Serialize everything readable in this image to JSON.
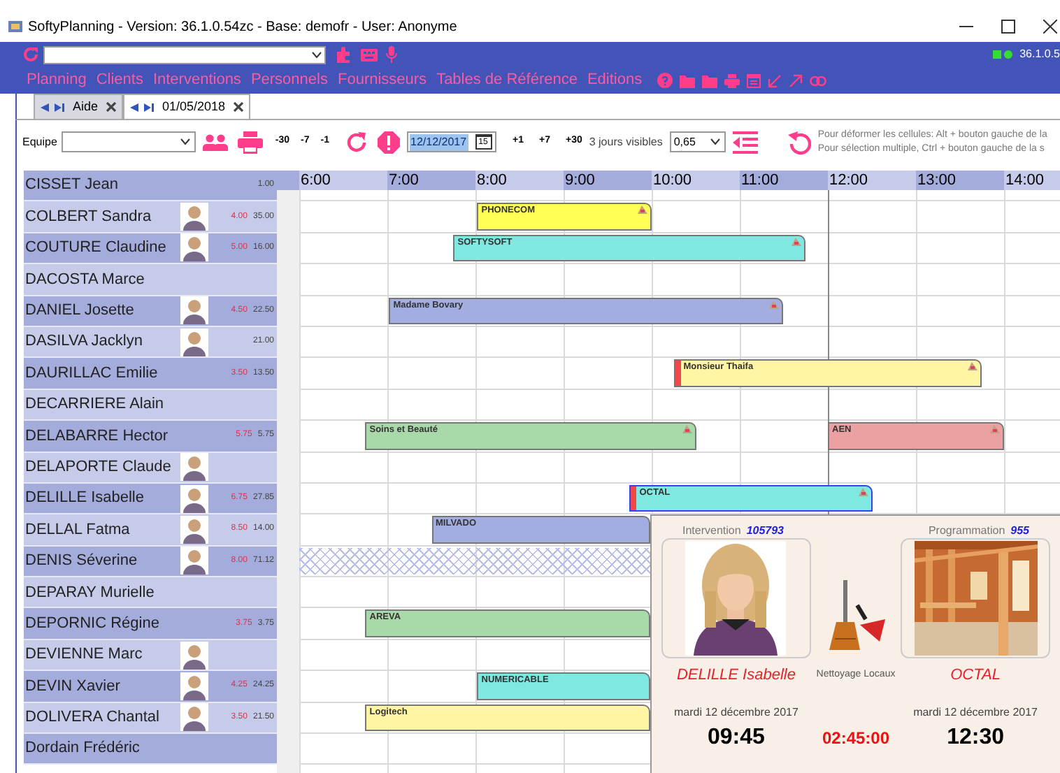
{
  "window": {
    "title": "SoftyPlanning - Version: 36.1.0.54zc - Base: demofr - User: Anonyme"
  },
  "top_bar": {
    "version": "36.1.0.5"
  },
  "menu": [
    {
      "label": "Planning"
    },
    {
      "label": "Clients"
    },
    {
      "label": "Interventions"
    },
    {
      "label": "Personnels"
    },
    {
      "label": "Fournisseurs"
    },
    {
      "label": "Tables de Référence"
    },
    {
      "label": "Editions"
    }
  ],
  "tabs": [
    {
      "label": "Aide",
      "selected": false
    },
    {
      "label": "01/05/2018",
      "selected": true
    }
  ],
  "toolbar": {
    "team_label": "Equipe",
    "back_steps": [
      "-30",
      "-7",
      "-1"
    ],
    "date": "12/12/2017",
    "calendar_day": "15",
    "forward_steps": [
      "+1",
      "+7",
      "+30"
    ],
    "days_visible": "3 jours visibles",
    "zoom": "0,65",
    "hints": [
      "Pour déformer les cellules: Alt + bouton gauche de la",
      "Pour sélection multiple, Ctrl + bouton gauche de la s"
    ]
  },
  "timeline": {
    "hours": [
      "6:00",
      "7:00",
      "8:00",
      "9:00",
      "10:00",
      "11:00",
      "12:00",
      "13:00",
      "14:00"
    ]
  },
  "rows": [
    {
      "name": "CISSET Jean",
      "photo": false,
      "value_2": "1.00",
      "bars": []
    },
    {
      "name": "COLBERT Sandra",
      "photo": true,
      "value_1": "4.00",
      "value_2": "35.00",
      "bars": [
        {
          "label": "PHONECOM",
          "color": "#ffff55",
          "flagged": false,
          "selected": false,
          "kind": "task"
        }
      ]
    },
    {
      "name": "COUTURE Claudine",
      "photo": true,
      "value_1": "5.00",
      "value_2": "16.00",
      "bars": [
        {
          "label": "SOFTYSOFT",
          "color": "#7fe8e0",
          "flagged": false,
          "selected": false,
          "kind": "task"
        }
      ]
    },
    {
      "name": "DACOSTA Marce",
      "photo": false,
      "bars": []
    },
    {
      "name": "DANIEL Josette",
      "photo": true,
      "value_1": "4.50",
      "value_2": "22.50",
      "bars": [
        {
          "label": "Madame Bovary",
          "color": "#a4addf",
          "flagged": false,
          "selected": false,
          "kind": "task"
        }
      ]
    },
    {
      "name": "DASILVA Jacklyn",
      "photo": true,
      "value_2": "21.00",
      "bars": []
    },
    {
      "name": "DAURILLAC Emilie",
      "photo": false,
      "value_1": "3.50",
      "value_2": "13.50",
      "bars": [
        {
          "label": "Monsieur Thaifa",
          "color": "#fff5a5",
          "flagged": true,
          "selected": false,
          "kind": "task"
        }
      ]
    },
    {
      "name": "DECARRIERE Alain",
      "photo": false,
      "bars": []
    },
    {
      "name": "DELABARRE Hector",
      "photo": false,
      "value_1": "5.75",
      "value_2": "5.75",
      "bars": [
        {
          "label": "Soins et Beauté",
          "color": "#a9d8a9",
          "flagged": false,
          "selected": false,
          "kind": "task"
        },
        {
          "label": "AEN",
          "color": "#eba1a1",
          "flagged": false,
          "selected": false,
          "kind": "task"
        }
      ]
    },
    {
      "name": "DELAPORTE Claude",
      "photo": true,
      "bars": []
    },
    {
      "name": "DELILLE Isabelle",
      "photo": true,
      "value_1": "6.75",
      "value_2": "27.85",
      "bars": [
        {
          "label": "OCTAL",
          "color": "#7fe8e0",
          "flagged": true,
          "selected": true,
          "kind": "task"
        }
      ]
    },
    {
      "name": "DELLAL Fatma",
      "photo": true,
      "value_1": "8.50",
      "value_2": "14.00",
      "bars": [
        {
          "label": "MILVADO",
          "color": "#a4addf",
          "flagged": false,
          "selected": false,
          "kind": "task"
        }
      ]
    },
    {
      "name": "DENIS Séverine",
      "photo": true,
      "value_1": "8.00",
      "value_2": "71.12",
      "bars": [
        {
          "kind": "unavailable"
        }
      ]
    },
    {
      "name": "DEPARAY Murielle",
      "photo": false,
      "bars": []
    },
    {
      "name": "DEPORNIC Régine",
      "photo": false,
      "value_1": "3.75",
      "value_2": "3.75",
      "bars": [
        {
          "label": "AREVA",
          "color": "#a9d8a9",
          "flagged": false,
          "selected": false,
          "kind": "task"
        }
      ]
    },
    {
      "name": "DEVIENNE Marc",
      "photo": true,
      "bars": []
    },
    {
      "name": "DEVIN Xavier",
      "photo": true,
      "value_1": "4.25",
      "value_2": "24.25",
      "bars": [
        {
          "label": "NUMERICABLE",
          "color": "#7fe8e0",
          "flagged": false,
          "selected": false,
          "kind": "task"
        }
      ]
    },
    {
      "name": "DOLIVERA Chantal",
      "photo": true,
      "value_1": "3.50",
      "value_2": "21.50",
      "bars": [
        {
          "label": "Logitech",
          "color": "#fff5a5",
          "flagged": false,
          "selected": false,
          "kind": "task"
        }
      ]
    },
    {
      "name": "Dordain Frédéric",
      "photo": false,
      "bars": []
    }
  ],
  "popup": {
    "intervention_label": "Intervention",
    "intervention_number": "105793",
    "programme_label": "Programmation",
    "programme_number": "955",
    "person": "DELILLE Isabelle",
    "task": "Nettoyage Locaux",
    "client": "OCTAL",
    "start_date": "mardi 12 décembre 2017",
    "start_time": "09:45",
    "duration": "02:45:00",
    "end_date": "mardi 12 décembre 2017",
    "end_time": "12:30"
  }
}
